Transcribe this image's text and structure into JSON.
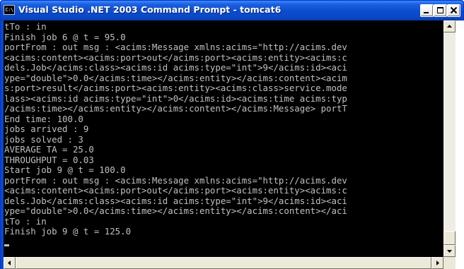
{
  "window": {
    "title": "Visual Studio .NET 2003 Command Prompt - tomcat6",
    "icon": "console-icon",
    "icon_text": "C:\\",
    "buttons": [
      "minimize-icon",
      "maximize-icon",
      "close-icon"
    ]
  },
  "console": {
    "lines": [
      "tTo : in",
      "Finish job 6 @ t = 95.0",
      "portFrom : out msg : <acims:Message xmlns:acims=\"http://acims.dev",
      "<acims:content><acims:port>out</acims:port><acims:entity><acims:c",
      "dels.Job</acims:class><acims:id acims:type=\"int\">9</acims:id><aci",
      "ype=\"double\">0.0</acims:time></acims:entity></acims:content><acim",
      "s:port>result</acims:port><acims:entity><acims:class>service.mode",
      "lass><acims:id acims:type=\"int\">0</acims:id><acims:time acims:typ",
      "/acims:time></acims:entity></acims:content></acims:Message> portT",
      "End time: 100.0",
      "jobs arrived : 9",
      "jobs solved : 3",
      "AVERAGE TA = 25.0",
      "THROUGHPUT = 0.03",
      "Start job 9 @ t = 100.0",
      "portFrom : out msg : <acims:Message xmlns:acims=\"http://acims.dev",
      "<acims:content><acims:port>out</acims:port><acims:entity><acims:c",
      "dels.Job</acims:class><acims:id acims:type=\"int\">9</acims:id><aci",
      "ype=\"double\">0.0</acims:time></acims:entity></acims:content></aci",
      "tTo : in",
      "Finish job 9 @ t = 125.0",
      ""
    ]
  },
  "colors": {
    "console_background": "#000000",
    "console_text": "#c0c0c0",
    "titlebar": "#0b4ccf"
  }
}
